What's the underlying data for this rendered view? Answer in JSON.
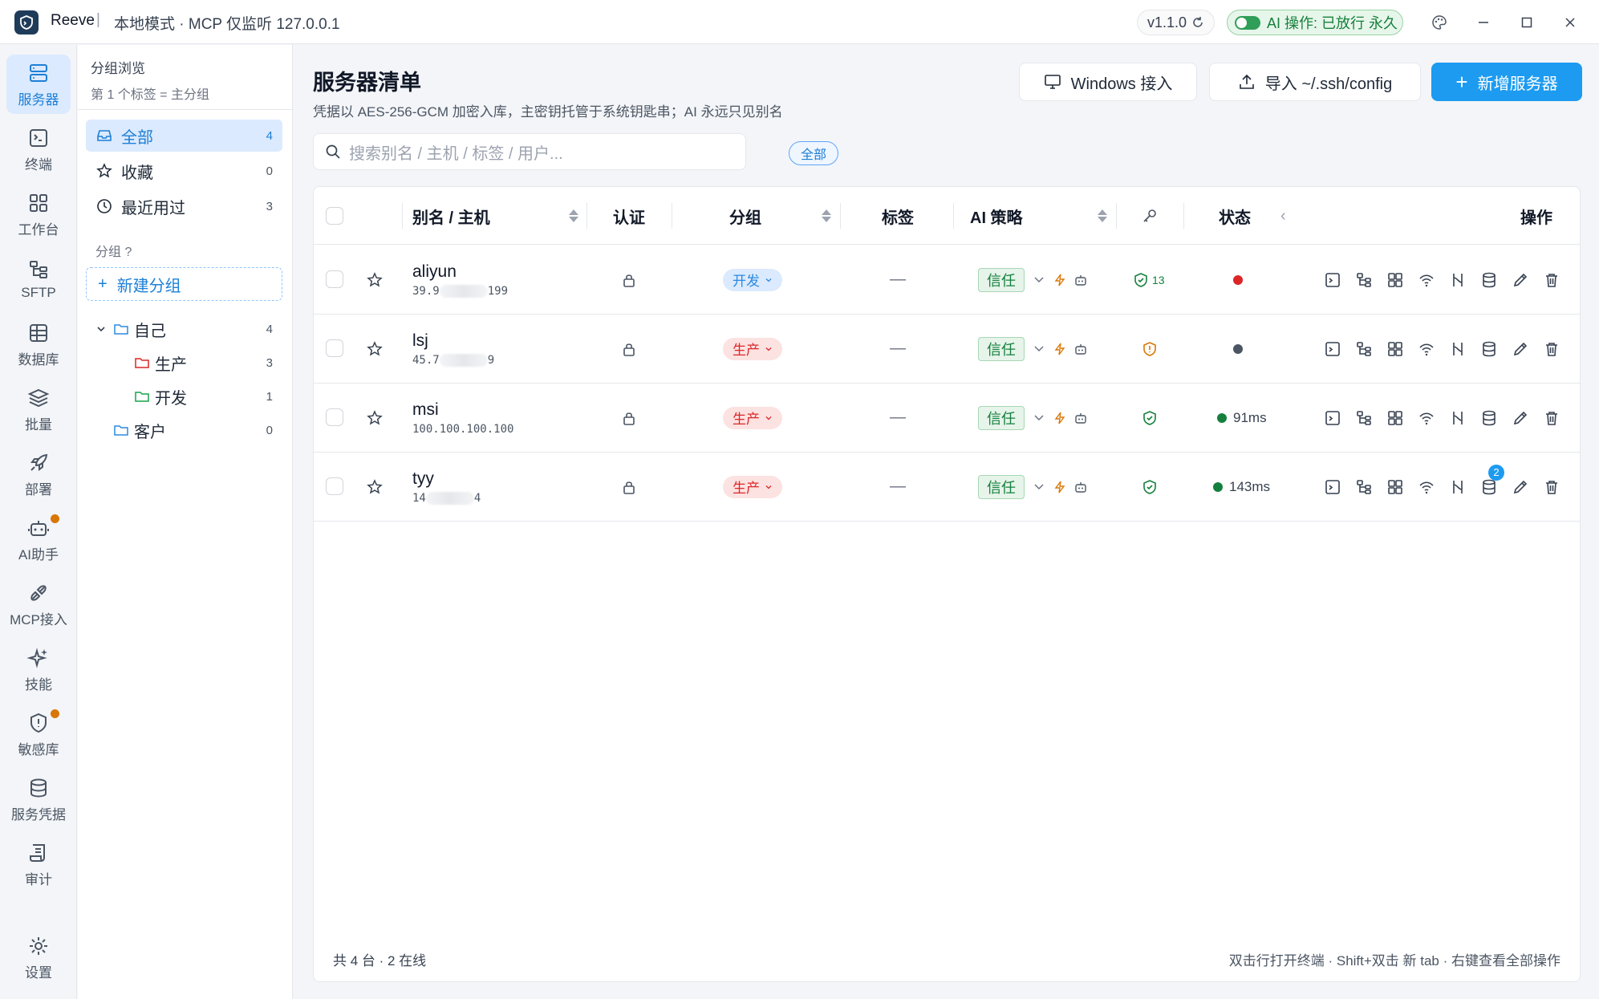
{
  "titlebar": {
    "app_name": "Reeve",
    "separator": "|",
    "mode": "本地模式 · MCP 仅监听 127.0.0.1",
    "version": "v1.1.0",
    "ai_status": "AI 操作: 已放行 永久"
  },
  "nav": [
    {
      "label": "服务器",
      "icon": "server-icon",
      "active": true
    },
    {
      "label": "终端",
      "icon": "terminal-icon"
    },
    {
      "label": "工作台",
      "icon": "grid-icon"
    },
    {
      "label": "SFTP",
      "icon": "sftp-icon"
    },
    {
      "label": "数据库",
      "icon": "database-icon"
    },
    {
      "label": "批量",
      "icon": "layers-icon"
    },
    {
      "label": "部署",
      "icon": "rocket-icon"
    },
    {
      "label": "AI助手",
      "icon": "bot-icon"
    },
    {
      "label": "MCP接入",
      "icon": "plug-icon"
    },
    {
      "label": "技能",
      "icon": "sparkles-icon"
    },
    {
      "label": "敏感库",
      "icon": "shield-icon"
    },
    {
      "label": "服务凭据",
      "icon": "credentials-icon"
    },
    {
      "label": "审计",
      "icon": "scroll-icon"
    },
    {
      "label": "设置",
      "icon": "gear-icon"
    }
  ],
  "groups": {
    "title": "分组浏览",
    "subtitle": "第 1 个标签 = 主分组",
    "filters": [
      {
        "label": "全部",
        "count": "4"
      },
      {
        "label": "收藏",
        "count": "0"
      },
      {
        "label": "最近用过",
        "count": "3"
      }
    ],
    "section_label": "分组 ?",
    "new_group": "新建分组",
    "tree": [
      {
        "label": "自己",
        "count": "4"
      },
      {
        "label": "生产",
        "count": "3"
      },
      {
        "label": "开发",
        "count": "1"
      },
      {
        "label": "客户",
        "count": "0"
      }
    ]
  },
  "main": {
    "title": "服务器清单",
    "subtitle": "凭据以 AES-256-GCM 加密入库，主密钥托管于系统钥匙串；AI 永远只见别名",
    "buttons": {
      "windows": "Windows 接入",
      "import": "导入 ~/.ssh/config",
      "add": "新增服务器"
    },
    "search_placeholder": "搜索别名 / 主机 / 标签 / 用户...",
    "filter_pill": "全部",
    "columns": {
      "alias": "别名 / 主机",
      "auth": "认证",
      "group": "分组",
      "tags": "标签",
      "ai_policy": "AI 策略",
      "status": "状态",
      "ops": "操作"
    },
    "rows": [
      {
        "alias": "aliyun",
        "host_prefix": "39.9",
        "host_suffix": "199",
        "group": "开发",
        "tags": "—",
        "policy": "信任",
        "key_count": "13",
        "latency": ""
      },
      {
        "alias": "lsj",
        "host_prefix": "45.7",
        "host_suffix": "9",
        "group": "生产",
        "tags": "—",
        "policy": "信任",
        "key_count": "",
        "latency": ""
      },
      {
        "alias": "msi",
        "host_prefix": "100.100.100.100",
        "host_suffix": "",
        "group": "生产",
        "tags": "—",
        "policy": "信任",
        "key_count": "",
        "latency": "91ms"
      },
      {
        "alias": "tyy",
        "host_prefix": "14",
        "host_suffix": "4",
        "group": "生产",
        "tags": "—",
        "policy": "信任",
        "key_count": "",
        "latency": "143ms",
        "badge": "2"
      }
    ],
    "footer_left": "共 4 台 · 2 在线",
    "footer_right": "双击行打开终端 · Shift+双击 新 tab · 右键查看全部操作"
  },
  "colors": {
    "accent": "#1d9bf0",
    "dev_tag": "#2b8ae0",
    "prod_tag": "#dc2626",
    "trust": "#15803d",
    "offline": "#dc2626",
    "unknown": "#4b5563",
    "online": "#15803d"
  }
}
